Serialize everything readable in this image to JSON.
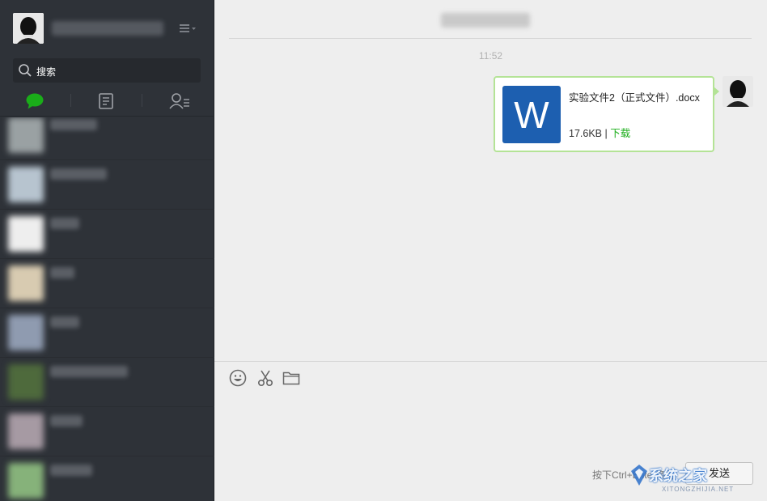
{
  "sidebar": {
    "search_placeholder": "搜索",
    "tabs": [
      "chat-tab",
      "article-tab",
      "contacts-tab"
    ]
  },
  "chat": {
    "timestamp": "11:52",
    "file_message": {
      "file_name": "实验文件2（正式文件）.docx",
      "file_type_letter": "W",
      "file_size": "17.6KB",
      "separator": "|",
      "download_label": "下载"
    }
  },
  "input": {
    "hint": "按下Ctrl+Enter换行",
    "send_label": "发送"
  },
  "watermark": {
    "text": "系统之家",
    "sub": "XITONGZHIJIA.NET"
  },
  "colors": {
    "sidebar_bg": "#2e3238",
    "main_bg": "#eeeeee",
    "bubble_border": "#b4e396",
    "word_blue": "#1d5fb0",
    "link_green": "#1aad19",
    "active_tab": "#1aad19"
  }
}
